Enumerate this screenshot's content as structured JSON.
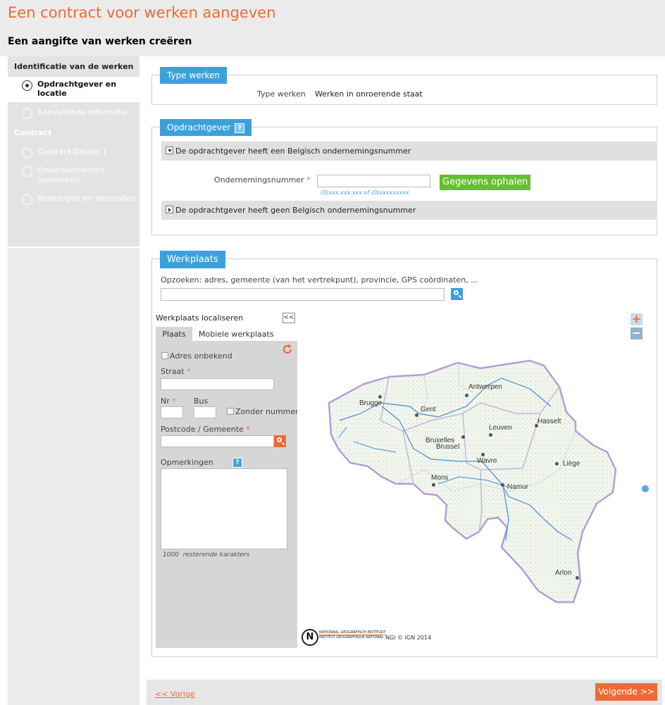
{
  "page": {
    "title": "Een contract voor werken aangeven",
    "subtitle": "Een aangifte van werken creëren"
  },
  "sidebar": {
    "section1": "Identificatie van de werken",
    "item_opdrachtgever": "Opdrachtgever en locatie",
    "item_aanvullend": "Aanvullende informatie",
    "section2": "Contract",
    "item_contract_details": "Contract Details 1",
    "item_onderaannemers": "Onderaannemers (optioneel)",
    "item_bevestigen": "Bevestigen en verzenden"
  },
  "type_werken": {
    "tab": "Type werken",
    "label": "Type werken",
    "value": "Werken in onroerende staat"
  },
  "opdrachtgever": {
    "tab": "Opdrachtgever",
    "help": "?",
    "belgian_bar": "De opdrachtgever heeft een Belgisch ondernemingsnummer",
    "ondernemingsnummer_label": "Ondernemingsnummer",
    "required_mark": "*",
    "ondernemingsnummer_value": "",
    "fetch_button": "Gegevens ophalen",
    "format_hint": "(0)xxx.xxx.xxx of (0)xxxxxxxxx",
    "foreign_bar": "De opdrachtgever heeft geen Belgisch ondernemingsnummer"
  },
  "werkplaats": {
    "tab": "Werkplaats",
    "search_label": "Opzoeken: adres, gemeente (van het vertrekpunt), provincie, GPS coördinaten, ...",
    "search_value": "",
    "localiseren_title": "Werkplaats localiseren",
    "collapse_label": "<<",
    "tab_plaats": "Plaats",
    "tab_mobiel": "Mobiele werkplaats",
    "adres_onbekend": "Adres onbekend",
    "straat_label": "Straat",
    "nr_label": "Nr",
    "bus_label": "Bus",
    "zonder_nummer": "Zonder nummer",
    "postcode_label": "Postcode / Gemeente",
    "opmerkingen_label": "Opmerkingen",
    "opmerkingen_help": "?",
    "remaining_count": "1000",
    "remaining_label": "resterende karakters"
  },
  "map": {
    "zoom_in": "+",
    "zoom_out": "−",
    "cities": {
      "antwerpen": "Antwerpen",
      "brugge": "Brugge",
      "gent": "Gent",
      "hasselt": "Hasselt",
      "leuven": "Leuven",
      "bruxelles": "Bruxelles",
      "brussel": "Brussel",
      "wavre": "Wavre",
      "liege": "Liège",
      "mons": "Mons",
      "namur": "Namur",
      "arlon": "Arlon"
    },
    "logo_letter": "N",
    "logo_line1": "NATIONAAL GEOGRAFISCH INSTITUUT",
    "logo_line2": "INSTITUT GÉOGRAPHIQUE NATIONAL",
    "copyright": "NGI © IGN 2014"
  },
  "footer": {
    "prev": "<< Vorige",
    "next": "Volgende >>"
  },
  "colors": {
    "accent_orange": "#ee6a34",
    "tab_blue": "#3ba1dc",
    "button_green": "#66bf2e"
  }
}
